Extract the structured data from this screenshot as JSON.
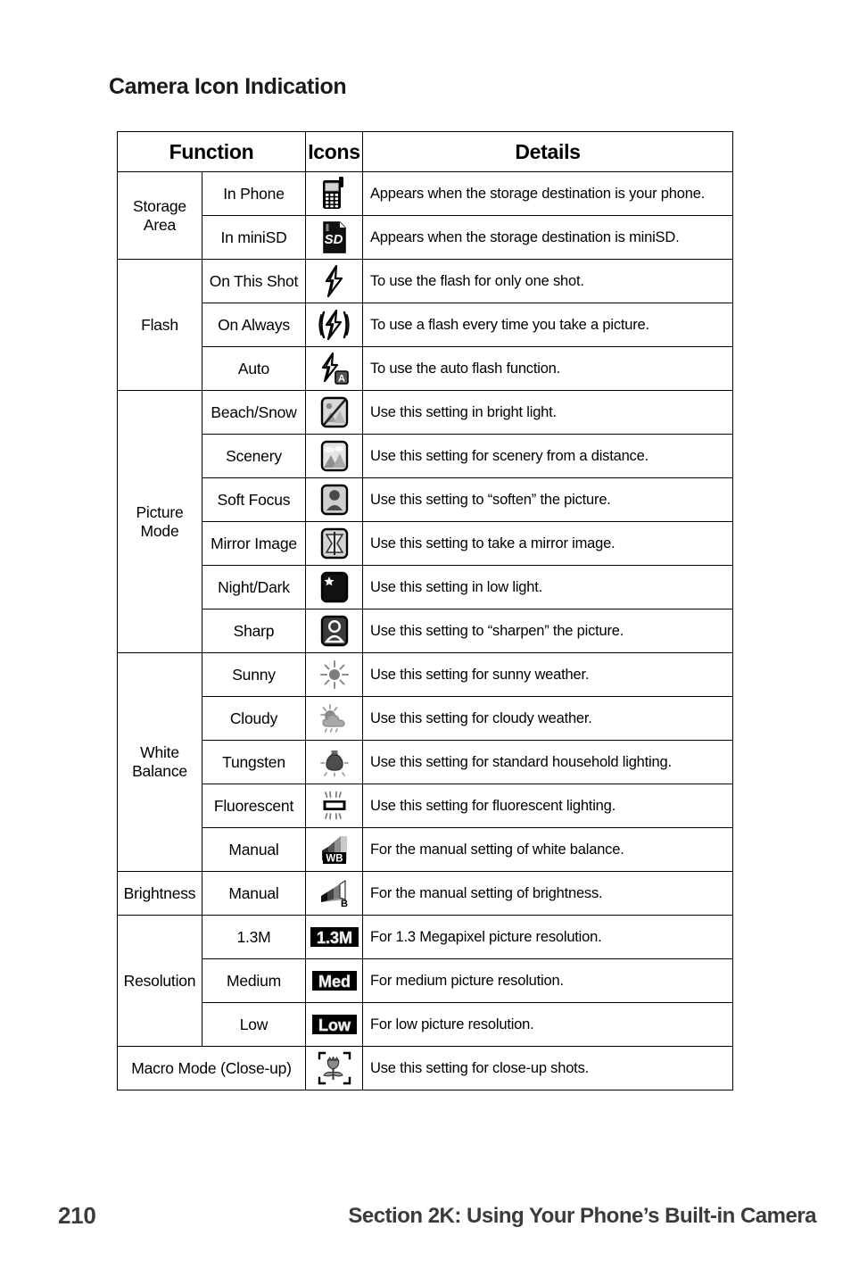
{
  "page": {
    "title": "Camera Icon Indication",
    "footer": {
      "page_number": "210",
      "section": "Section 2K: Using Your Phone’s Built-in Camera"
    }
  },
  "table": {
    "headers": {
      "function": "Function",
      "icons": "Icons",
      "details": "Details"
    },
    "groups": [
      {
        "function": "Storage\nArea",
        "function_line1": "Storage",
        "function_line2": "Area",
        "rows": [
          {
            "setting": "In Phone",
            "icon": "phone-icon",
            "details": "Appears when the storage destination is your phone."
          },
          {
            "setting": "In miniSD",
            "icon": "minisd-card-icon",
            "details": "Appears when the storage destination is miniSD."
          }
        ]
      },
      {
        "function": "Flash",
        "function_line1": "Flash",
        "function_line2": "",
        "rows": [
          {
            "setting": "On This Shot",
            "icon": "flash-once-icon",
            "details": "To use the flash for only one shot."
          },
          {
            "setting": "On Always",
            "icon": "flash-always-icon",
            "details": "To use a flash every time you take a picture."
          },
          {
            "setting": "Auto",
            "icon": "flash-auto-icon",
            "details": "To use the auto flash function."
          }
        ]
      },
      {
        "function": "Picture\nMode",
        "function_line1": "Picture",
        "function_line2": "Mode",
        "rows": [
          {
            "setting": "Beach/Snow",
            "icon": "beach-snow-icon",
            "details": "Use this setting in bright light."
          },
          {
            "setting": "Scenery",
            "icon": "scenery-icon",
            "details": "Use this setting for scenery from a distance."
          },
          {
            "setting": "Soft Focus",
            "icon": "soft-focus-icon",
            "details": "Use this setting to “soften” the picture."
          },
          {
            "setting": "Mirror Image",
            "icon": "mirror-image-icon",
            "details": "Use this setting to take a mirror image."
          },
          {
            "setting": "Night/Dark",
            "icon": "night-dark-icon",
            "details": "Use this setting in low light."
          },
          {
            "setting": "Sharp",
            "icon": "sharp-icon",
            "details": "Use this setting to “sharpen” the picture."
          }
        ]
      },
      {
        "function": "White\nBalance",
        "function_line1": "White",
        "function_line2": "Balance",
        "rows": [
          {
            "setting": "Sunny",
            "icon": "sunny-icon",
            "details": "Use this setting for sunny weather."
          },
          {
            "setting": "Cloudy",
            "icon": "cloudy-icon",
            "details": "Use this setting for cloudy weather."
          },
          {
            "setting": "Tungsten",
            "icon": "tungsten-bulb-icon",
            "details": "Use this setting for standard household lighting."
          },
          {
            "setting": "Fluorescent",
            "icon": "fluorescent-icon",
            "details": "Use this setting for fluorescent lighting."
          },
          {
            "setting": "Manual",
            "icon": "manual-wb-icon",
            "details": "For the manual setting of white balance."
          }
        ]
      },
      {
        "function": "Brightness",
        "function_line1": "Brightness",
        "function_line2": "",
        "rows": [
          {
            "setting": "Manual",
            "icon": "manual-brightness-icon",
            "details": "For the manual setting of brightness."
          }
        ]
      },
      {
        "function": "Resolution",
        "function_line1": "Resolution",
        "function_line2": "",
        "rows": [
          {
            "setting": "1.3M",
            "icon": "res-13m-icon",
            "details": "For 1.3 Megapixel picture resolution."
          },
          {
            "setting": "Medium",
            "icon": "res-med-icon",
            "details": "For medium picture resolution."
          },
          {
            "setting": "Low",
            "icon": "res-low-icon",
            "details": "For low picture resolution."
          }
        ]
      }
    ],
    "full_width_row": {
      "label": "Macro Mode (Close-up)",
      "icon": "macro-flower-icon",
      "details": "Use this setting for close-up shots."
    }
  }
}
